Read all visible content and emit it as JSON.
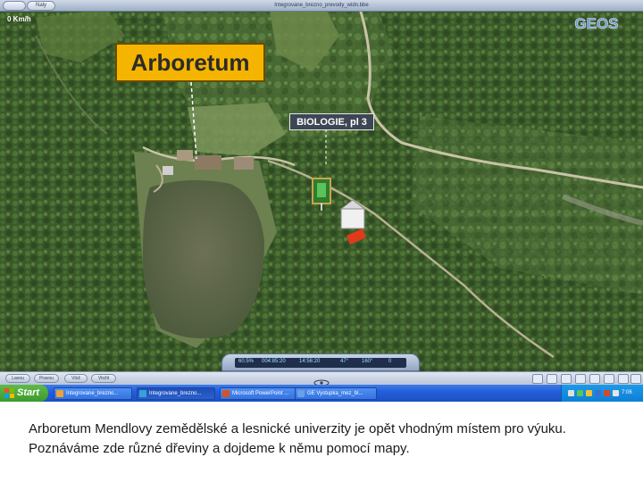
{
  "window": {
    "title": "Integrovane_brezno_prevody_widn.bbe",
    "left_buttons": [
      "",
      "Naly"
    ]
  },
  "hud": {
    "speed": "0 Km/h",
    "logo": "GEOS"
  },
  "map_labels": {
    "arboretum": "Arboretum",
    "biologie": "BIOLOGIE, pl 3"
  },
  "controls": {
    "bottom_buttons": [
      "Lavou",
      "Pravou",
      "Vlož",
      "Vložit"
    ],
    "readout_values": [
      "60.5%",
      "004:85:20",
      "14:56:20",
      "47°",
      "160°",
      "0"
    ]
  },
  "taskbar": {
    "start_label": "Start",
    "tasks": [
      {
        "label": "Integrovane_brezno...",
        "color": "#e8a33a",
        "active": false
      },
      {
        "label": "Integrovane_brezno...",
        "color": "#3aa0d8",
        "active": true
      },
      {
        "label": "Microsoft PowerPoint ...",
        "color": "#d2522b",
        "active": false
      },
      {
        "label": "GE Vystupka_mez_bl...",
        "color": "#6aa0e6",
        "active": false
      }
    ],
    "clock": "7:06"
  },
  "caption": "Arboretum Mendlovy zemědělské a lesnické univerzity je opět vhodným místem pro výuku. Poznáváme zde různé dřeviny a dojdeme k němu pomocí mapy.",
  "colors": {
    "label_yellow": "#f5b400",
    "label_dark": "#3d4654",
    "taskbar_blue": "#245edb",
    "start_green": "#3b9a2c"
  }
}
